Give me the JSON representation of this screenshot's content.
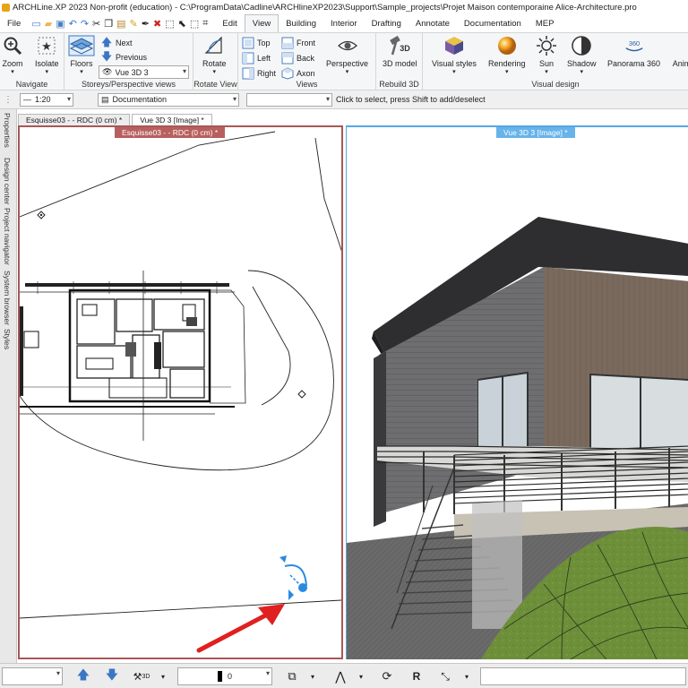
{
  "window": {
    "title": "ARCHLine.XP 2023 Non-profit (education) - C:\\ProgramData\\Cadline\\ARCHlineXP2023\\Support\\Sample_projects\\Projet Maison contemporaine Alice-Architecture.pro"
  },
  "tabs": [
    {
      "label": "File"
    },
    {
      "label": "Edit"
    },
    {
      "label": "View"
    },
    {
      "label": "Building"
    },
    {
      "label": "Interior"
    },
    {
      "label": "Drafting"
    },
    {
      "label": "Annotate"
    },
    {
      "label": "Documentation"
    },
    {
      "label": "MEP"
    }
  ],
  "ribbon": {
    "navigate": {
      "label": "Navigate",
      "zoom": "Zoom",
      "isolate": "Isolate"
    },
    "storeys": {
      "label": "Storeys/Perspective views",
      "floors": "Floors",
      "next": "Next",
      "previous": "Previous",
      "view_select": "Vue 3D 3"
    },
    "rotate_view": {
      "label": "Rotate View",
      "rotate": "Rotate"
    },
    "views": {
      "label": "Views",
      "top": "Top",
      "front": "Front",
      "left": "Left",
      "back": "Back",
      "right": "Right",
      "axon": "Axon",
      "perspective": "Perspective"
    },
    "rebuild": {
      "label": "Rebuild 3D",
      "model": "3D model"
    },
    "visual": {
      "label": "Visual design",
      "styles": "Visual styles",
      "rendering": "Rendering",
      "sun": "Sun",
      "shadow": "Shadow",
      "panorama": "Panorama 360",
      "animation": "Anim"
    }
  },
  "toolbar2": {
    "scale": "1:20",
    "layer": "Documentation",
    "layer_filter": "",
    "status": "Click to select, press Shift to add/deselect"
  },
  "doc_tabs": [
    {
      "label": "Esquisse03 -  - RDC (0 cm) *"
    },
    {
      "label": "Vue 3D 3 [Image] *"
    }
  ],
  "side_panel": [
    "Properties",
    "Design center",
    "Project navigator",
    "System browser",
    "Styles"
  ],
  "viewports": {
    "left_title": "Esquisse03 -  - RDC (0 cm) *",
    "right_title": "Vue 3D 3 [Image] *"
  },
  "bottom": {
    "pen_value": "0",
    "icon_3d_label": "3D"
  },
  "colors": {
    "accent_blue": "#56a7e2",
    "left_frame": "#a85757",
    "arrow_red": "#e02020"
  }
}
